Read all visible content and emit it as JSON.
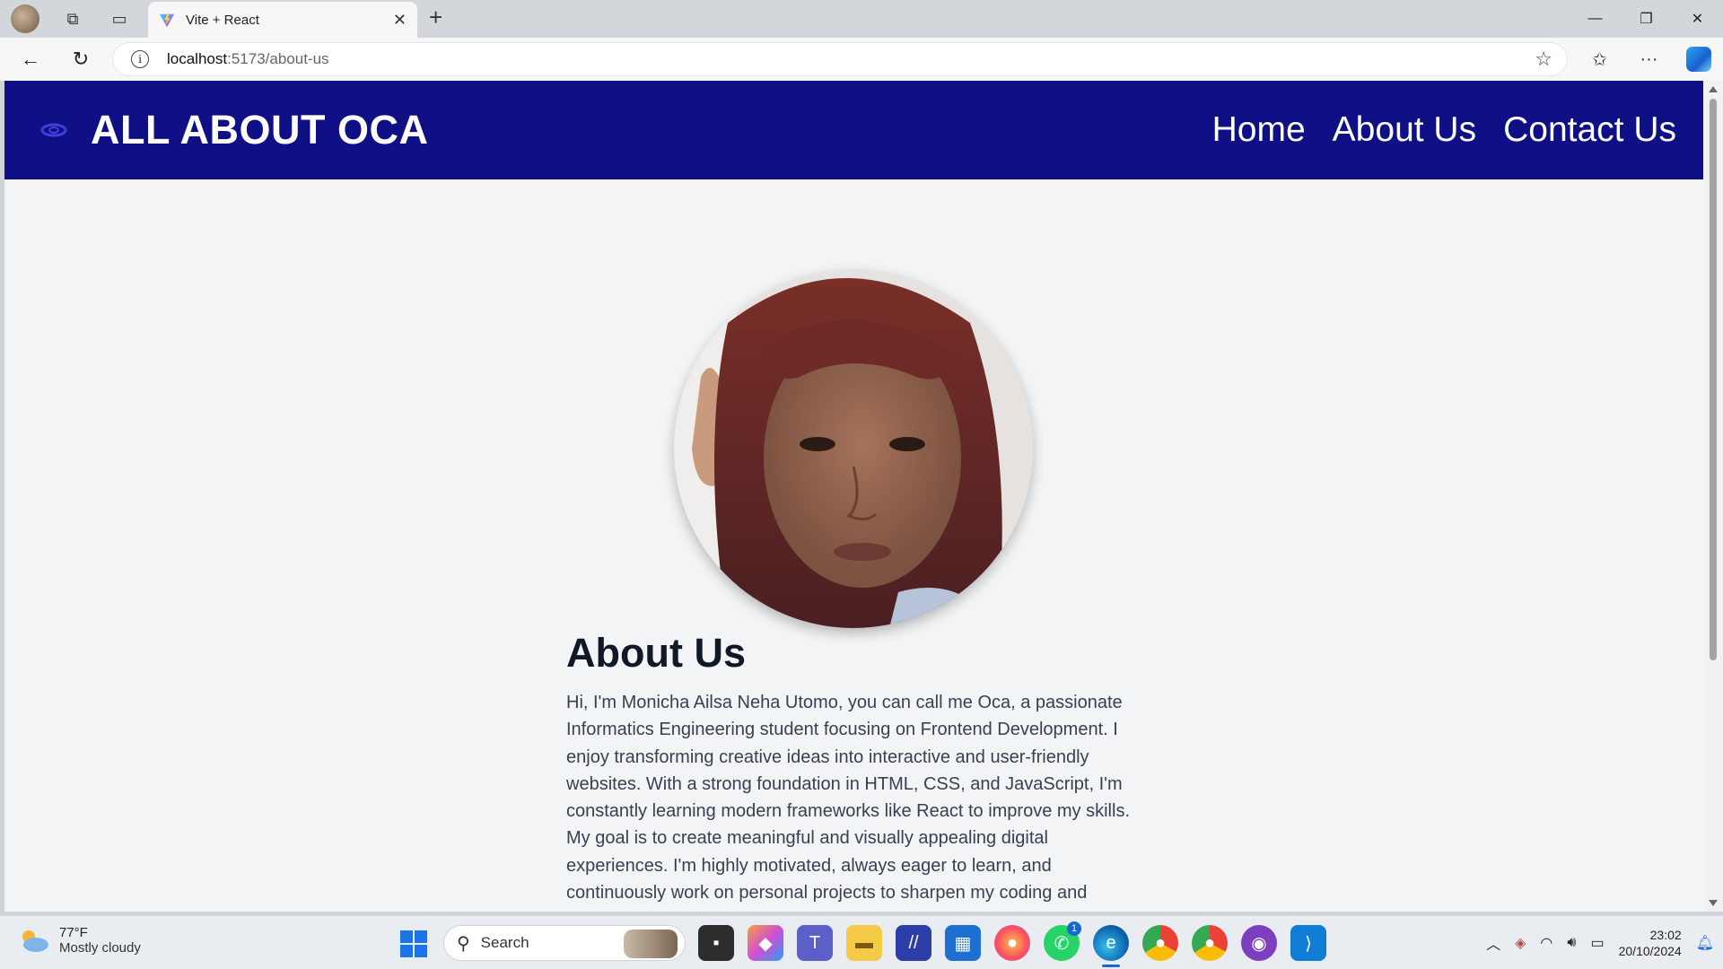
{
  "browser": {
    "tab_title": "Vite + React",
    "url_host": "localhost",
    "url_path": ":5173/about-us"
  },
  "site": {
    "brand": "ALL ABOUT OCA",
    "nav": [
      "Home",
      "About Us",
      "Contact Us"
    ],
    "header_color": "#0f0f86"
  },
  "about": {
    "title": "About Us",
    "paragraph": "Hi, I'm Monicha Ailsa Neha Utomo, you can call me Oca, a passionate Informatics Engineering student focusing on Frontend Development. I enjoy transforming creative ideas into interactive and user-friendly websites. With a strong foundation in HTML, CSS, and JavaScript, I'm constantly learning modern frameworks like React to improve my skills. My goal is to create meaningful and visually appealing digital experiences. I'm highly motivated, always eager to learn, and continuously work on personal projects to sharpen my coding and"
  },
  "taskbar": {
    "weather_temp": "77°F",
    "weather_desc": "Mostly cloudy",
    "search_label": "Search",
    "whatsapp_badge": "1",
    "time": "23:02",
    "date": "20/10/2024"
  }
}
